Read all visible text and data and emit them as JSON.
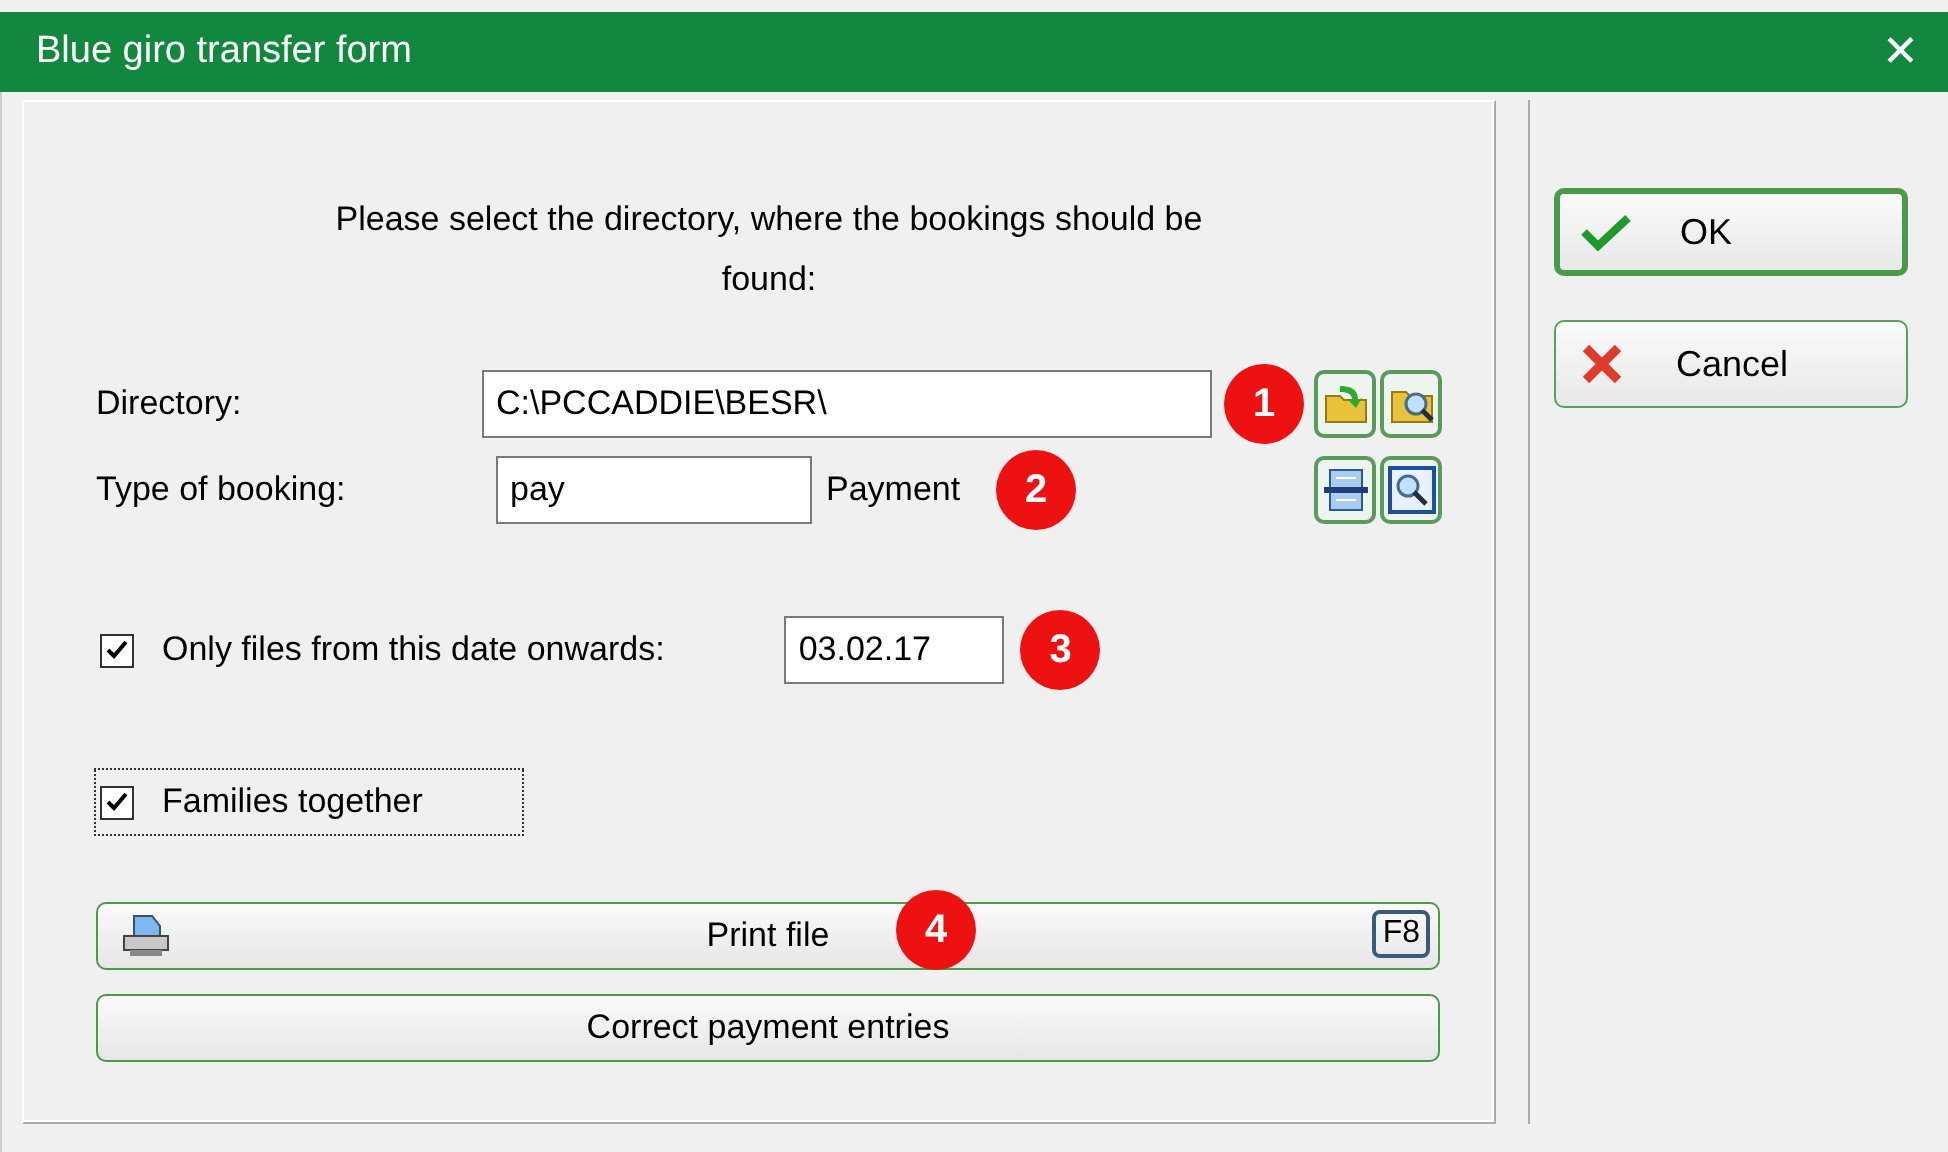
{
  "window": {
    "title": "Blue giro transfer form",
    "close": "✕"
  },
  "instruction": "Please select the directory, where the bookings should be found:",
  "directory": {
    "label": "Directory:",
    "value": "C:\\PCCADDIE\\BESR\\",
    "marker": "1"
  },
  "booking_type": {
    "label": "Type of booking:",
    "value": "pay",
    "description": "Payment",
    "marker": "2"
  },
  "date_filter": {
    "label": "Only files from this date onwards:",
    "checked": true,
    "value": "03.02.17",
    "marker": "3"
  },
  "families": {
    "label": "Families together",
    "checked": true,
    "focused": true
  },
  "print_button": {
    "label": "Print file",
    "shortcut": "F8",
    "marker": "4"
  },
  "correct_button": {
    "label": "Correct payment entries"
  },
  "buttons": [
    {
      "kind": "ok",
      "label": "OK",
      "default": true
    },
    {
      "kind": "cancel",
      "label": "Cancel",
      "default": false
    }
  ]
}
